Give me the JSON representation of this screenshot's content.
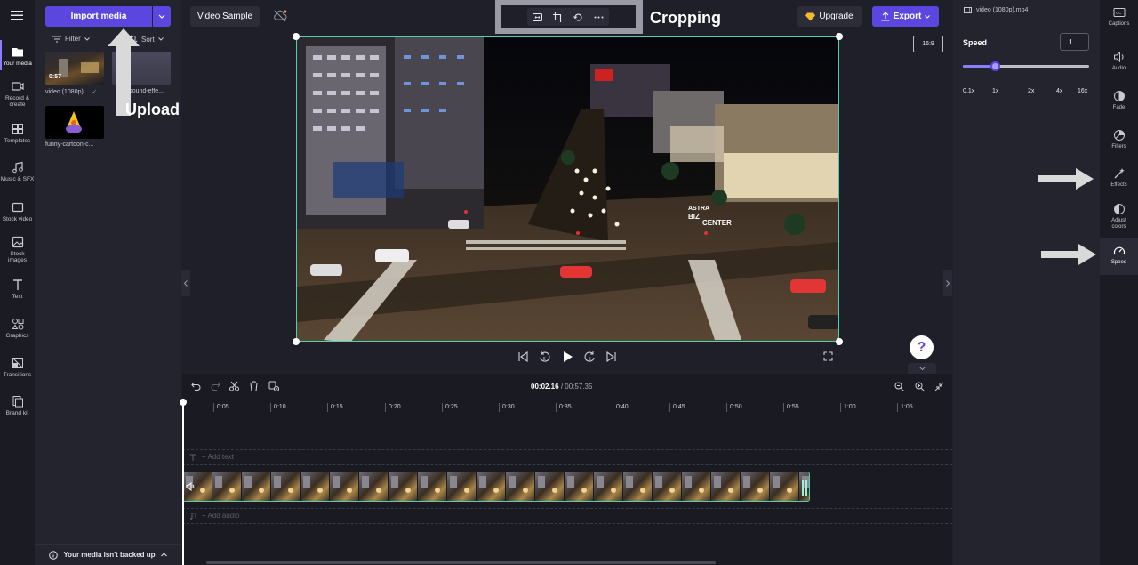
{
  "left_rail": {
    "items": [
      {
        "label": "Your media",
        "icon": "folder-icon"
      },
      {
        "label": "Record & create",
        "icon": "camera-icon"
      },
      {
        "label": "Templates",
        "icon": "templates-icon"
      },
      {
        "label": "Music & SFX",
        "icon": "music-icon"
      },
      {
        "label": "Stock video",
        "icon": "film-icon"
      },
      {
        "label": "Stock images",
        "icon": "image-icon"
      },
      {
        "label": "Text",
        "icon": "text-icon"
      },
      {
        "label": "Graphics",
        "icon": "graphics-icon"
      },
      {
        "label": "Transitions",
        "icon": "transitions-icon"
      },
      {
        "label": "Brand kit",
        "icon": "brand-kit-icon"
      }
    ]
  },
  "media_panel": {
    "import_label": "Import media",
    "filter_label": "Filter",
    "sort_label": "Sort",
    "media": [
      {
        "duration": "0:57",
        "name": "video (1080p)...."
      },
      {
        "duration": "01",
        "name": "h-sound-effe..."
      },
      {
        "duration": "",
        "name": "funny-cartoon-c..."
      }
    ],
    "backup_text": "Your media isn't backed up"
  },
  "annotations": {
    "upload": "Upload",
    "cropping": "Cropping"
  },
  "header": {
    "project_title": "Video Sample",
    "upgrade_label": "Upgrade",
    "export_label": "Export",
    "aspect_ratio": "16:9"
  },
  "preview": {
    "sign_line1": "ASTRA",
    "sign_line2": "BIZ",
    "sign_line3": "CENTER"
  },
  "help_label": "?",
  "timeline": {
    "current_time": "00:02.16",
    "separator": " / ",
    "total_time": "00:57.35",
    "ticks": [
      "0:05",
      "0:10",
      "0:15",
      "0:20",
      "0:25",
      "0:30",
      "0:35",
      "0:40",
      "0:45",
      "0:50",
      "0:55",
      "1:00",
      "1:05"
    ],
    "add_text": "+ Add text",
    "add_audio": "+ Add audio"
  },
  "properties": {
    "file_name": "video (1080p).mp4",
    "speed_title": "Speed",
    "speed_value": "1",
    "speed_fraction": 0.25,
    "speed_marks": [
      "0.1x",
      "1x",
      "2x",
      "4x",
      "16x"
    ]
  },
  "right_rail": {
    "items": [
      {
        "label": "Captions",
        "icon": "captions-icon"
      },
      {
        "label": "Audio",
        "icon": "audio-icon"
      },
      {
        "label": "Fade",
        "icon": "fade-icon"
      },
      {
        "label": "Filters",
        "icon": "filters-icon"
      },
      {
        "label": "Effects",
        "icon": "effects-icon"
      },
      {
        "label": "Adjust colors",
        "icon": "adjust-colors-icon"
      },
      {
        "label": "Speed",
        "icon": "speed-icon"
      }
    ]
  },
  "colors": {
    "accent": "#5b47e0",
    "selection": "#4fd1b0",
    "background": "#1f1f2a"
  }
}
